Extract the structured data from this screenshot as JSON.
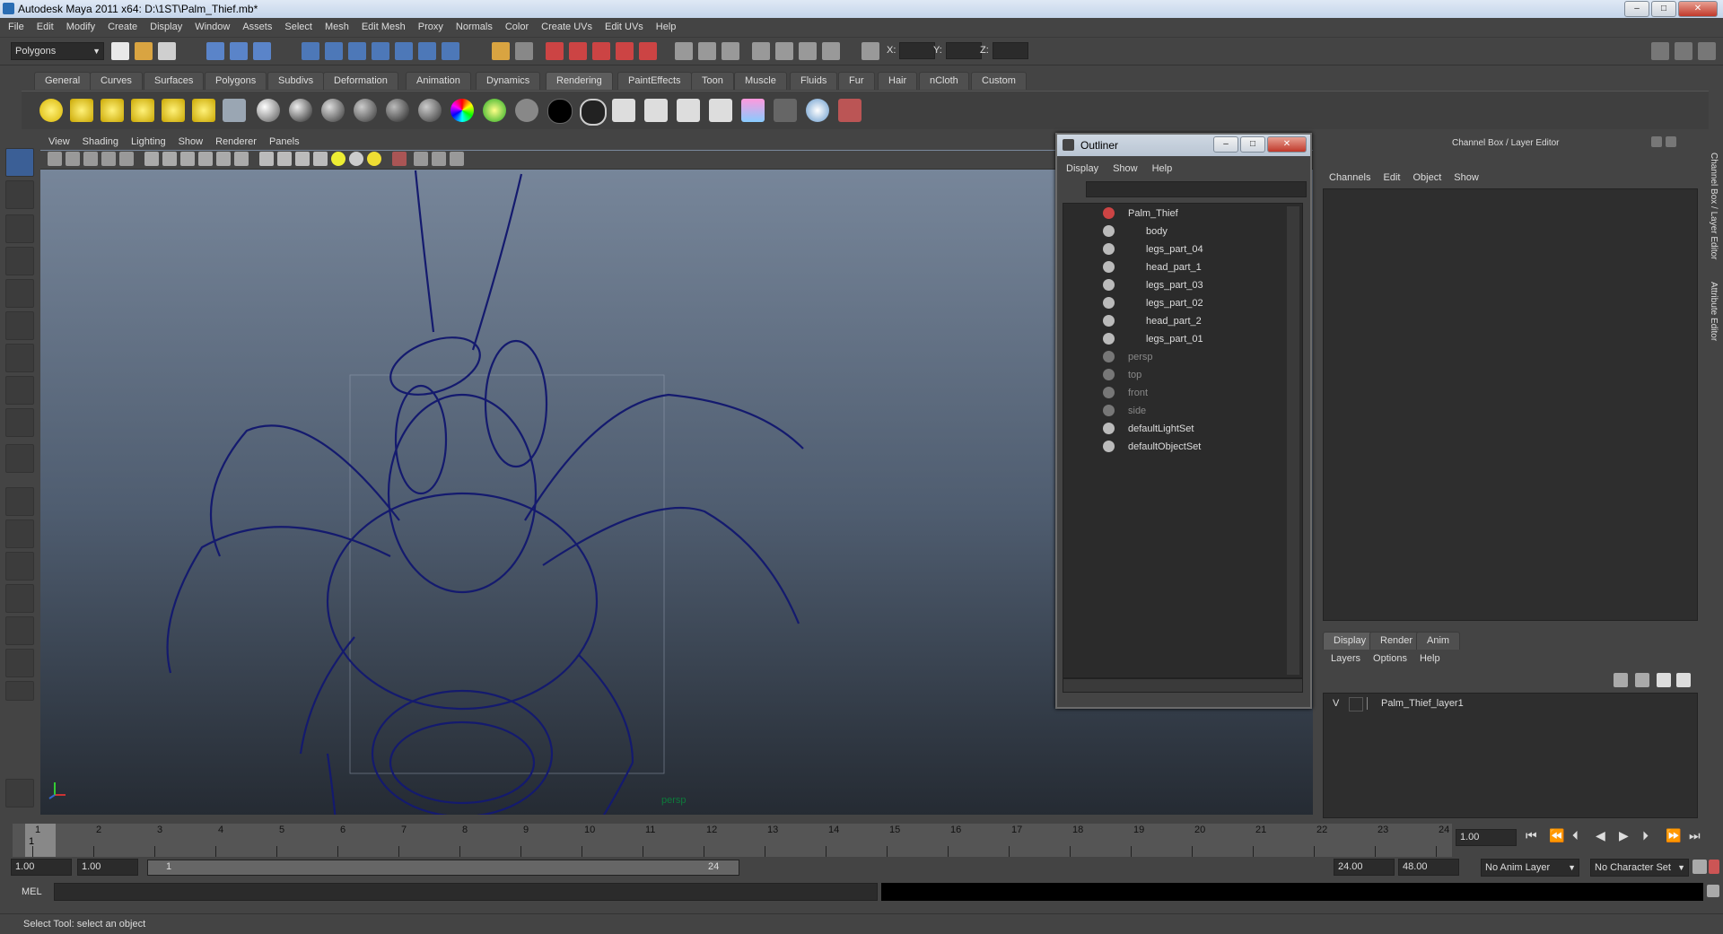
{
  "window": {
    "title": "Autodesk Maya 2011 x64: D:\\1ST\\Palm_Thief.mb*"
  },
  "menubar": {
    "items": [
      "File",
      "Edit",
      "Modify",
      "Create",
      "Display",
      "Window",
      "Assets",
      "Select",
      "Mesh",
      "Edit Mesh",
      "Proxy",
      "Normals",
      "Color",
      "Create UVs",
      "Edit UVs",
      "Help"
    ]
  },
  "statusline": {
    "mode": "Polygons",
    "x_label": "X:",
    "y_label": "Y:",
    "z_label": "Z:"
  },
  "shelf_tabs": {
    "items": [
      "General",
      "Curves",
      "Surfaces",
      "Polygons",
      "Subdivs",
      "Deformation",
      "Animation",
      "Dynamics",
      "Rendering",
      "PaintEffects",
      "Toon",
      "Muscle",
      "Fluids",
      "Fur",
      "Hair",
      "nCloth",
      "Custom"
    ],
    "active": "Rendering"
  },
  "viewport": {
    "menu": [
      "View",
      "Shading",
      "Lighting",
      "Show",
      "Renderer",
      "Panels"
    ],
    "camera_label": "persp",
    "wire_color": "#141a6e"
  },
  "outliner": {
    "title": "Outliner",
    "menu": [
      "Display",
      "Show",
      "Help"
    ],
    "items": [
      {
        "label": "Palm_Thief",
        "indent": 0,
        "dim": false
      },
      {
        "label": "body",
        "indent": 1,
        "dim": false
      },
      {
        "label": "legs_part_04",
        "indent": 1,
        "dim": false
      },
      {
        "label": "head_part_1",
        "indent": 1,
        "dim": false
      },
      {
        "label": "legs_part_03",
        "indent": 1,
        "dim": false
      },
      {
        "label": "legs_part_02",
        "indent": 1,
        "dim": false
      },
      {
        "label": "head_part_2",
        "indent": 1,
        "dim": false
      },
      {
        "label": "legs_part_01",
        "indent": 1,
        "dim": false
      },
      {
        "label": "persp",
        "indent": 0,
        "dim": true
      },
      {
        "label": "top",
        "indent": 0,
        "dim": true
      },
      {
        "label": "front",
        "indent": 0,
        "dim": true
      },
      {
        "label": "side",
        "indent": 0,
        "dim": true
      },
      {
        "label": "defaultLightSet",
        "indent": 0,
        "dim": false
      },
      {
        "label": "defaultObjectSet",
        "indent": 0,
        "dim": false
      }
    ]
  },
  "channelbox": {
    "title": "Channel Box / Layer Editor",
    "menu": [
      "Channels",
      "Edit",
      "Object",
      "Show"
    ],
    "side_tabs": [
      "Channel Box / Layer Editor",
      "Attribute Editor"
    ],
    "layer_tabs": [
      "Display",
      "Render",
      "Anim"
    ],
    "layer_menu": [
      "Layers",
      "Options",
      "Help"
    ],
    "layer": {
      "visible": "V",
      "name": "Palm_Thief_layer1"
    }
  },
  "timeline": {
    "ticks": [
      "1",
      "2",
      "3",
      "4",
      "5",
      "6",
      "7",
      "8",
      "9",
      "10",
      "11",
      "12",
      "13",
      "14",
      "15",
      "16",
      "17",
      "18",
      "19",
      "20",
      "21",
      "22",
      "23",
      "24"
    ],
    "current_frame": "1.00",
    "current_marker": "1"
  },
  "range": {
    "start": "1.00",
    "playback_start": "1.00",
    "slider_start": "1",
    "slider_end": "24",
    "playback_end": "24.00",
    "end": "48.00",
    "anim_layer": "No Anim Layer",
    "character_set": "No Character Set"
  },
  "cmdline": {
    "label": "MEL"
  },
  "helpline": {
    "text": "Select Tool: select an object"
  }
}
